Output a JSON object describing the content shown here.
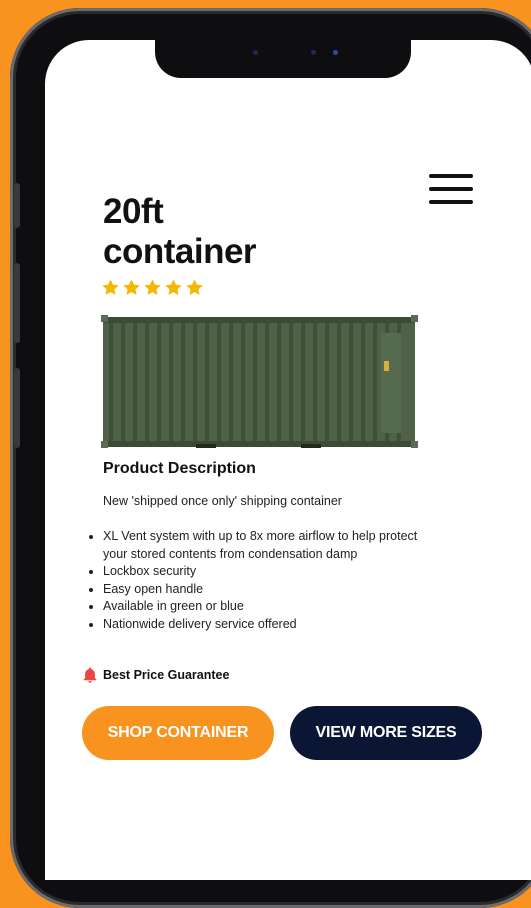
{
  "product": {
    "title_line1": "20ft",
    "title_line2": "container",
    "rating": 5,
    "description_heading": "Product Description",
    "description_text": "New 'shipped once only' shipping container",
    "features": [
      "XL Vent system with up to 8x more airflow to help protect your stored contents from condensation damp",
      "Lockbox security",
      "Easy open handle",
      "Available in green or blue",
      "Nationwide delivery service offered"
    ],
    "guarantee": "Best Price Guarantee"
  },
  "actions": {
    "shop_label": "SHOP CONTAINER",
    "sizes_label": "VIEW MORE SIZES"
  },
  "colors": {
    "accent": "#f7931e",
    "dark_button": "#0a1633",
    "star": "#f5b800",
    "bell": "#f04545",
    "container_green": "#4f6248"
  },
  "icons": {
    "menu": "hamburger-menu-icon",
    "star": "star-icon",
    "bell": "bell-icon"
  }
}
